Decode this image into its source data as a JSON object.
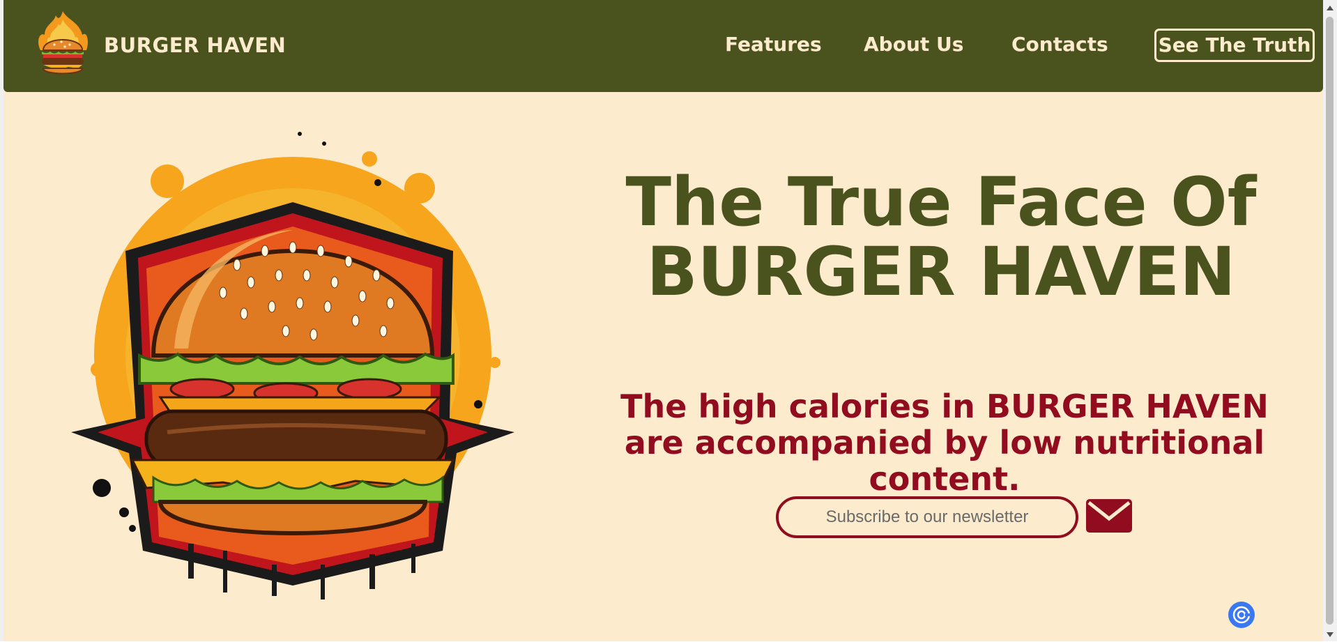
{
  "header": {
    "brand": "BURGER HAVEN",
    "logo_icon": "flaming-burger-logo",
    "nav": [
      "Features",
      "About Us",
      "Contacts"
    ],
    "cta": "See The Truth"
  },
  "hero": {
    "title_line1": "The True Face Of",
    "title_line2": "BURGER HAVEN",
    "subtitle_line1": "The high calories in BURGER HAVEN",
    "subtitle_line2": "are accompanied by low nutritional content.",
    "newsletter": {
      "placeholder": "Subscribe to our newsletter",
      "value": ""
    },
    "mail_icon": "envelope-icon",
    "illustration": "burger-illustration"
  },
  "colors": {
    "header_bg": "#4a521e",
    "page_bg": "#fdebcd",
    "accent_green": "#4a521e",
    "accent_red": "#900c1e",
    "fab_blue": "#3a78f2"
  }
}
